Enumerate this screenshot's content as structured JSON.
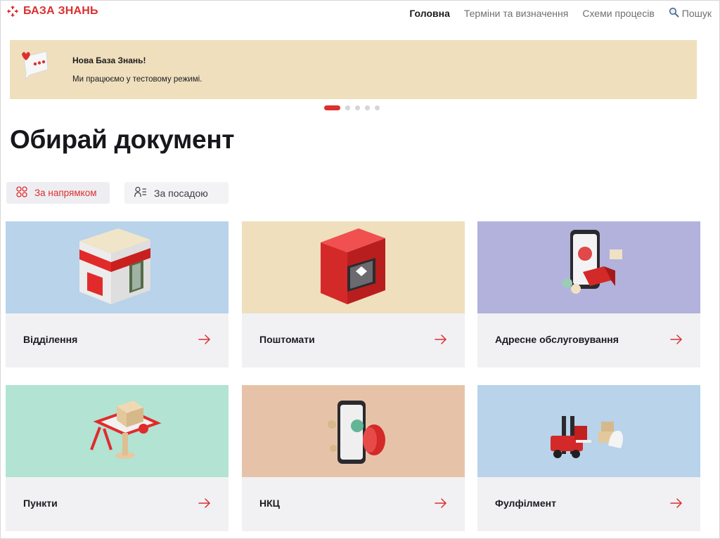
{
  "header": {
    "logo_text": "БАЗА ЗНАНЬ",
    "nav": [
      {
        "label": "Головна",
        "active": true
      },
      {
        "label": "Терміни та визначення",
        "active": false
      },
      {
        "label": "Схеми процесів",
        "active": false
      }
    ],
    "search_label": "Пошук"
  },
  "banner": {
    "title": "Нова База Знань!",
    "text": "Ми працюємо у тестовому режимі.",
    "background": "#efdfbd",
    "slides_total": 5,
    "active_slide": 1
  },
  "page_title": "Обирай документ",
  "filters": {
    "by_direction": "За напрямком",
    "by_position": "За посадою",
    "active": "by_direction"
  },
  "accent_color": "#dc2f2f",
  "cards": [
    {
      "label": "Відділення",
      "bg": "#b8d3ea",
      "icon": "branch-building-icon"
    },
    {
      "label": "Поштомати",
      "bg": "#efdfbd",
      "icon": "parcel-locker-icon"
    },
    {
      "label": "Адресне обслуговування",
      "bg": "#b2b2dc",
      "icon": "address-delivery-icon"
    },
    {
      "label": "Пункти",
      "bg": "#b2e3d3",
      "icon": "pickup-point-icon"
    },
    {
      "label": "НКЦ",
      "bg": "#e6c3a8",
      "icon": "contact-center-icon"
    },
    {
      "label": "Фулфілмент",
      "bg": "#b8d3ea",
      "icon": "fulfillment-forklift-icon"
    }
  ]
}
